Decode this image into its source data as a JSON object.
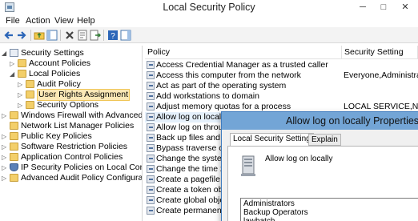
{
  "window": {
    "title": "Local Security Policy"
  },
  "window_controls": {
    "minimize": "─",
    "maximize": "□",
    "close": "✕"
  },
  "menu": [
    "File",
    "Action",
    "View",
    "Help"
  ],
  "toolbar": [
    "back-icon",
    "forward-icon",
    "up-folder-icon",
    "show-hide-tree-icon",
    "delete-icon",
    "properties-icon",
    "export-list-icon",
    "help-icon",
    "show-action-pane-icon"
  ],
  "tree": {
    "root": "Security Settings",
    "items": [
      "Account Policies",
      "Local Policies",
      "Audit Policy",
      "User Rights Assignment",
      "Security Options",
      "Windows Firewall with Advanced Secu",
      "Network List Manager Policies",
      "Public Key Policies",
      "Software Restriction Policies",
      "Application Control Policies",
      "IP Security Policies on Local Compute",
      "Advanced Audit Policy Configuration"
    ]
  },
  "list": {
    "columns": [
      "Policy",
      "Security Setting"
    ],
    "rows": [
      {
        "policy": "Access Credential Manager as a trusted caller",
        "setting": ""
      },
      {
        "policy": "Access this computer from the network",
        "setting": "Everyone,Administrators"
      },
      {
        "policy": "Act as part of the operating system",
        "setting": ""
      },
      {
        "policy": "Add workstations to domain",
        "setting": ""
      },
      {
        "policy": "Adjust memory quotas for a process",
        "setting": "LOCAL SERVICE,NETWO..."
      },
      {
        "policy": "Allow log on locally",
        "setting": ""
      },
      {
        "policy": "Allow log on through",
        "setting": ""
      },
      {
        "policy": "Back up files and direc",
        "setting": ""
      },
      {
        "policy": "Bypass traverse checki",
        "setting": ""
      },
      {
        "policy": "Change the system tim",
        "setting": ""
      },
      {
        "policy": "Change the time zone",
        "setting": ""
      },
      {
        "policy": "Create a pagefile",
        "setting": ""
      },
      {
        "policy": "Create a token object",
        "setting": ""
      },
      {
        "policy": "Create global objects",
        "setting": ""
      },
      {
        "policy": "Create permanent sha",
        "setting": ""
      }
    ]
  },
  "dialog": {
    "title": "Allow log on locally Properties",
    "tabs": [
      "Local Security Setting",
      "Explain"
    ],
    "policy_name": "Allow log on locally",
    "users": [
      "Administrators",
      "Backup Operators",
      "lawbatch"
    ]
  }
}
